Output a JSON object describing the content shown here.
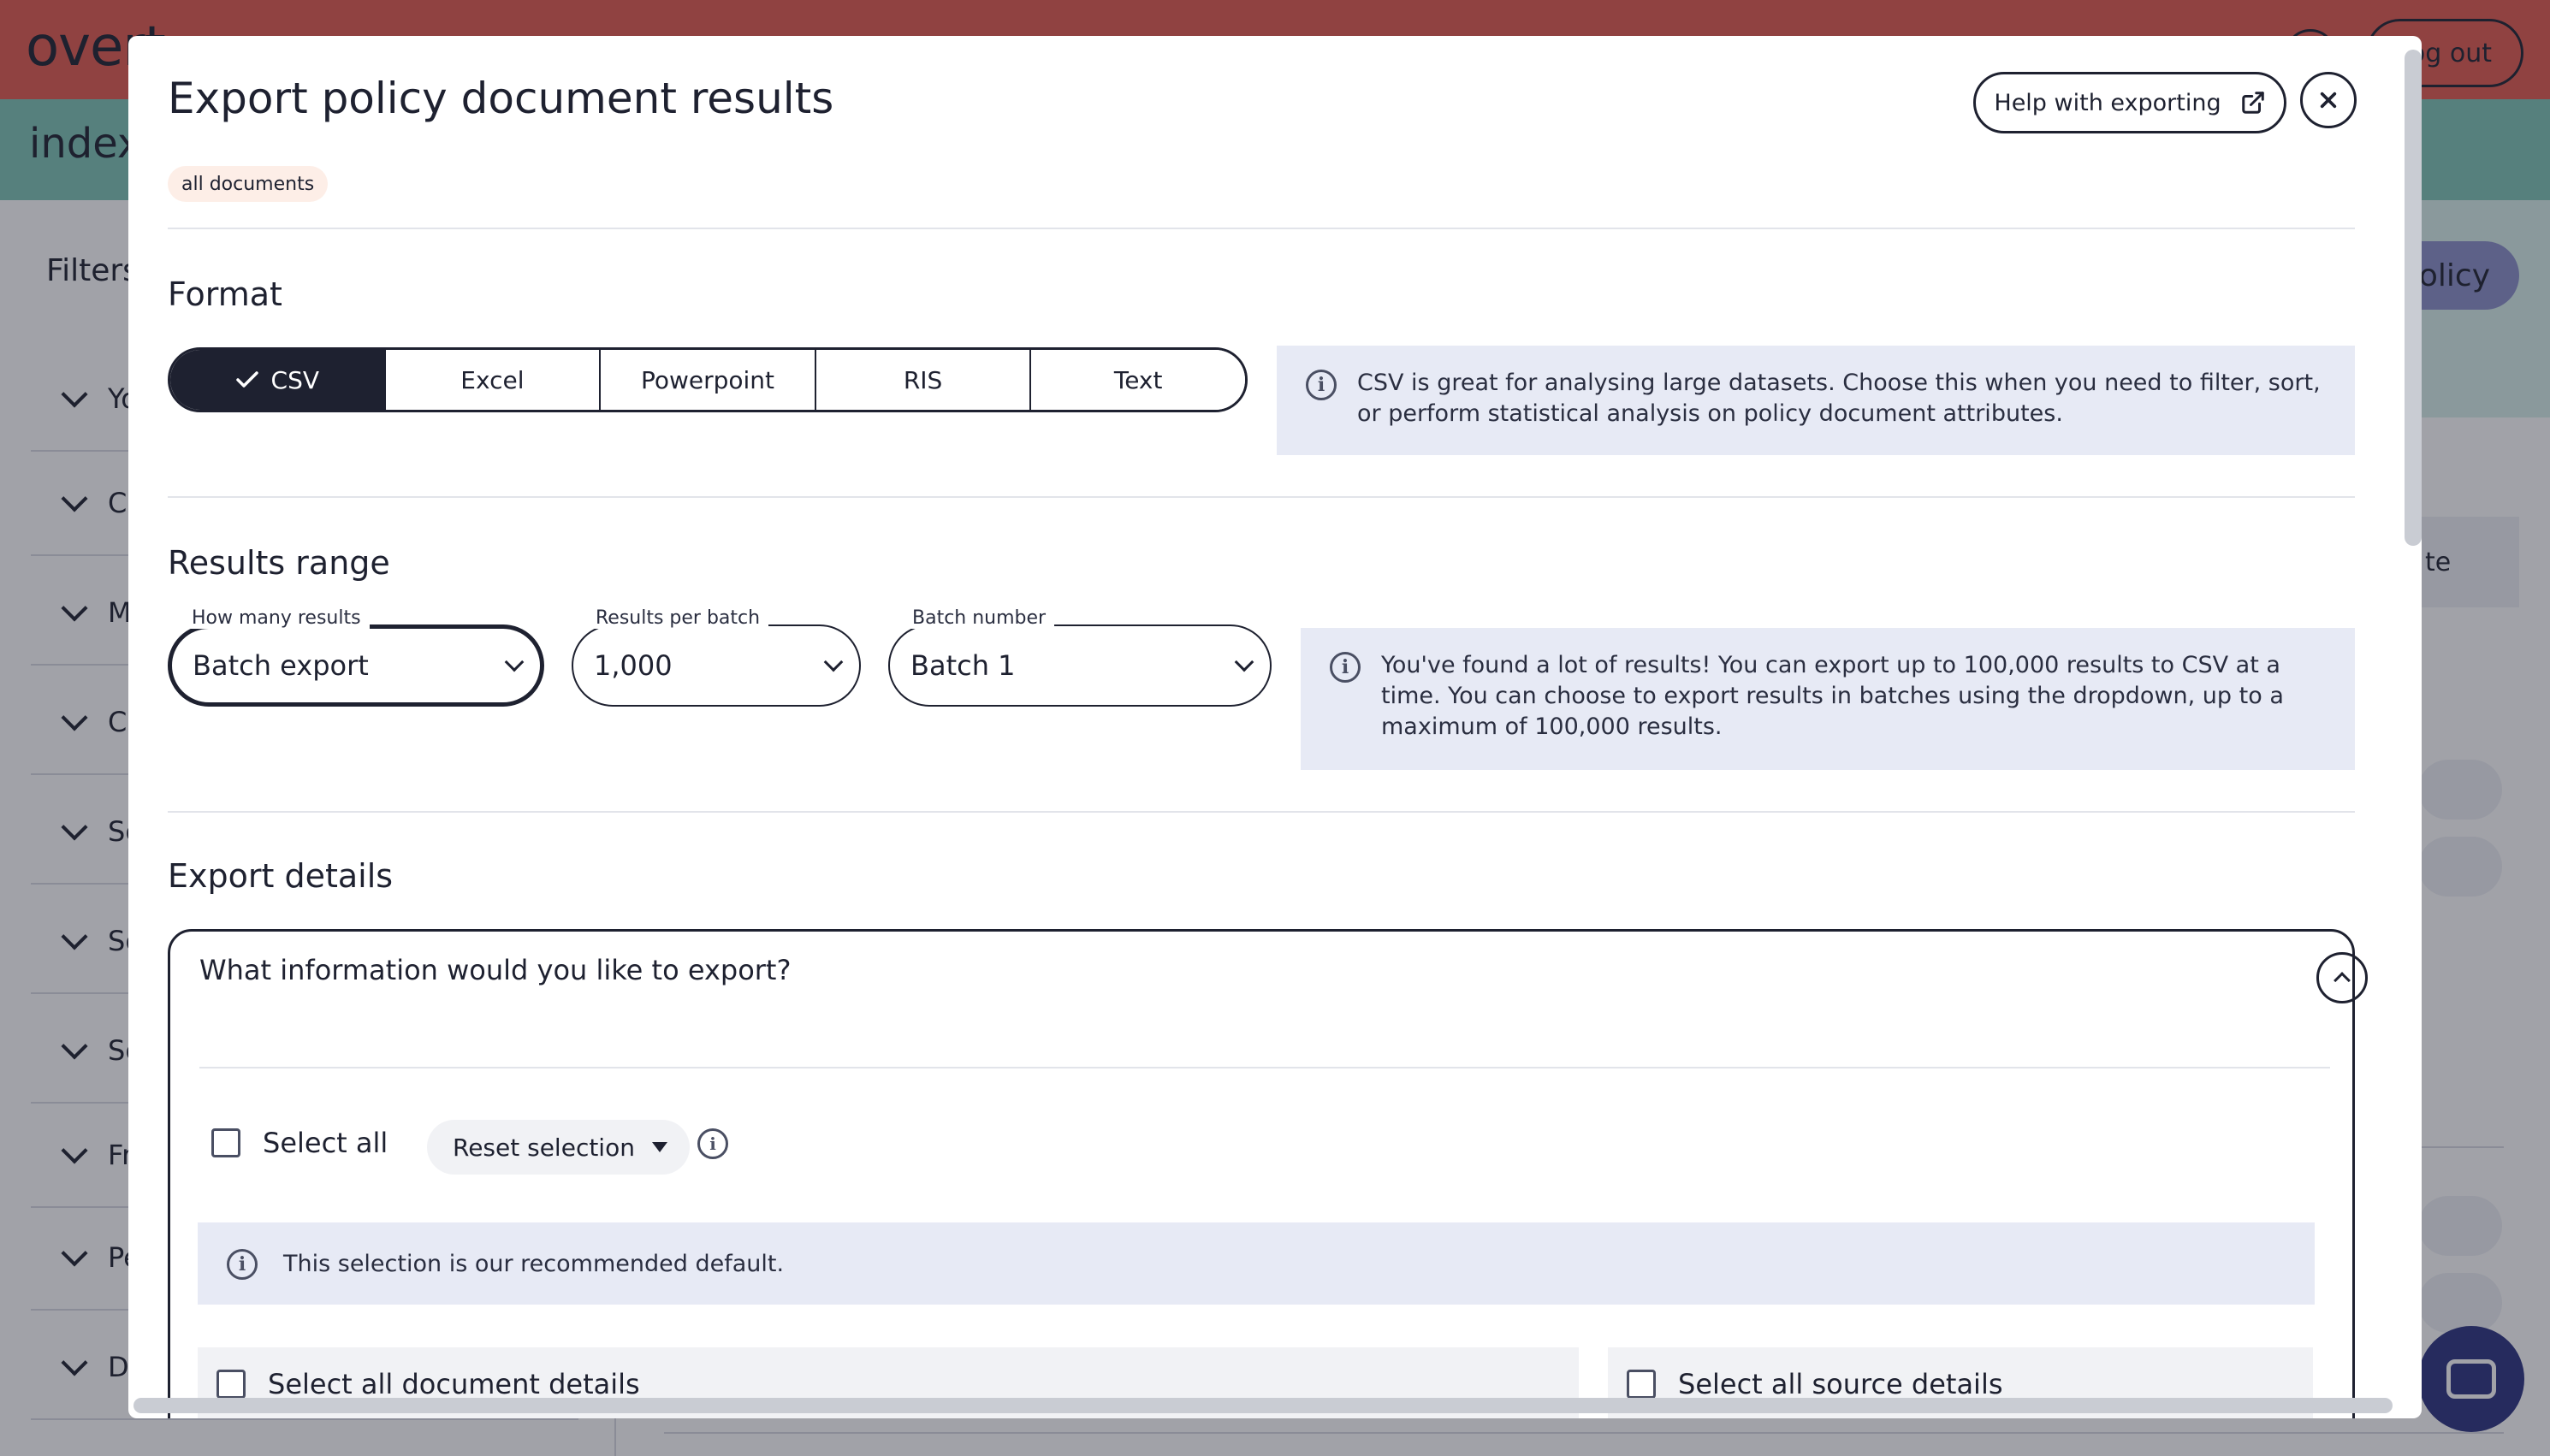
{
  "background": {
    "logo": "overt",
    "logout_label": "Log out",
    "subtitle": "index",
    "filters_title": "Filters",
    "filter_items": [
      "Yo",
      "Ci",
      "Mo",
      "Cit",
      "So",
      "So",
      "So",
      "Fr",
      "Pe",
      "Do"
    ],
    "policy_button_label": "policy",
    "sort_label": "te"
  },
  "modal": {
    "title": "Export policy document results",
    "help_label": "Help with exporting",
    "close_icon": "close-icon",
    "tag": "all documents",
    "format": {
      "title": "Format",
      "options": [
        "CSV",
        "Excel",
        "Powerpoint",
        "RIS",
        "Text"
      ],
      "selected": "CSV",
      "info": "CSV is great for analysing large datasets. Choose this when you need to filter, sort, or perform statistical analysis on policy document attributes."
    },
    "results_range": {
      "title": "Results range",
      "how_many_label": "How many results",
      "how_many_value": "Batch export",
      "per_batch_label": "Results per batch",
      "per_batch_value": "1,000",
      "batch_number_label": "Batch number",
      "batch_number_value": "Batch 1",
      "info": "You've found a lot of results! You can export up to 100,000 results to CSV at a time. You can choose to export results in batches using the dropdown, up to a maximum of 100,000 results."
    },
    "export_details": {
      "title": "Export details",
      "question": "What information would you like to export?",
      "select_all_label": "Select all",
      "reset_label": "Reset selection",
      "recommended_note": "This selection is our recommended default.",
      "document_details_label": "Select all document details",
      "source_details_label": "Select all source details"
    }
  }
}
